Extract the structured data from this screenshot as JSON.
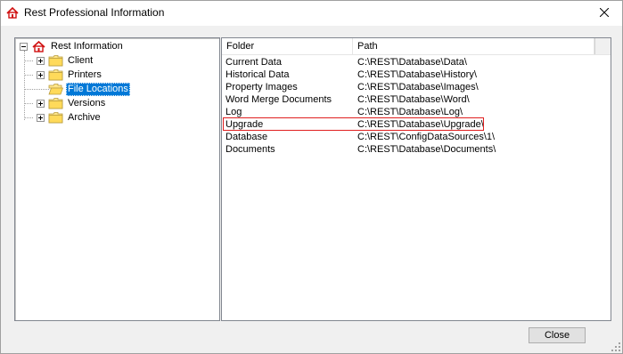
{
  "window": {
    "title": "Rest Professional Information",
    "app_icon": "house-icon",
    "close_icon": "close-icon"
  },
  "tree": {
    "root_label": "Rest Information",
    "items": [
      {
        "label": "Client",
        "icon": "folder-icon",
        "expandable": true
      },
      {
        "label": "Printers",
        "icon": "folder-icon",
        "expandable": true
      },
      {
        "label": "File Locations",
        "icon": "folder-open-icon",
        "expandable": false,
        "selected": true
      },
      {
        "label": "Versions",
        "icon": "folder-icon",
        "expandable": true
      },
      {
        "label": "Archive",
        "icon": "folder-icon",
        "expandable": true
      }
    ]
  },
  "list": {
    "columns": [
      "Folder",
      "Path"
    ],
    "rows": [
      {
        "folder": "Current Data",
        "path": "C:\\REST\\Database\\Data\\"
      },
      {
        "folder": "Historical Data",
        "path": "C:\\REST\\Database\\History\\"
      },
      {
        "folder": "Property Images",
        "path": "C:\\REST\\Database\\Images\\"
      },
      {
        "folder": "Word Merge Documents",
        "path": "C:\\REST\\Database\\Word\\"
      },
      {
        "folder": "Log",
        "path": "C:\\REST\\Database\\Log\\"
      },
      {
        "folder": "Upgrade",
        "path": "C:\\REST\\Database\\Upgrade\\"
      },
      {
        "folder": "Database",
        "path": "C:\\REST\\ConfigDataSources\\1\\"
      },
      {
        "folder": "Documents",
        "path": "C:\\REST\\Database\\Documents\\"
      }
    ],
    "highlighted_row": "Upgrade",
    "highlight_color": "#e02020"
  },
  "footer": {
    "close_label": "Close"
  }
}
